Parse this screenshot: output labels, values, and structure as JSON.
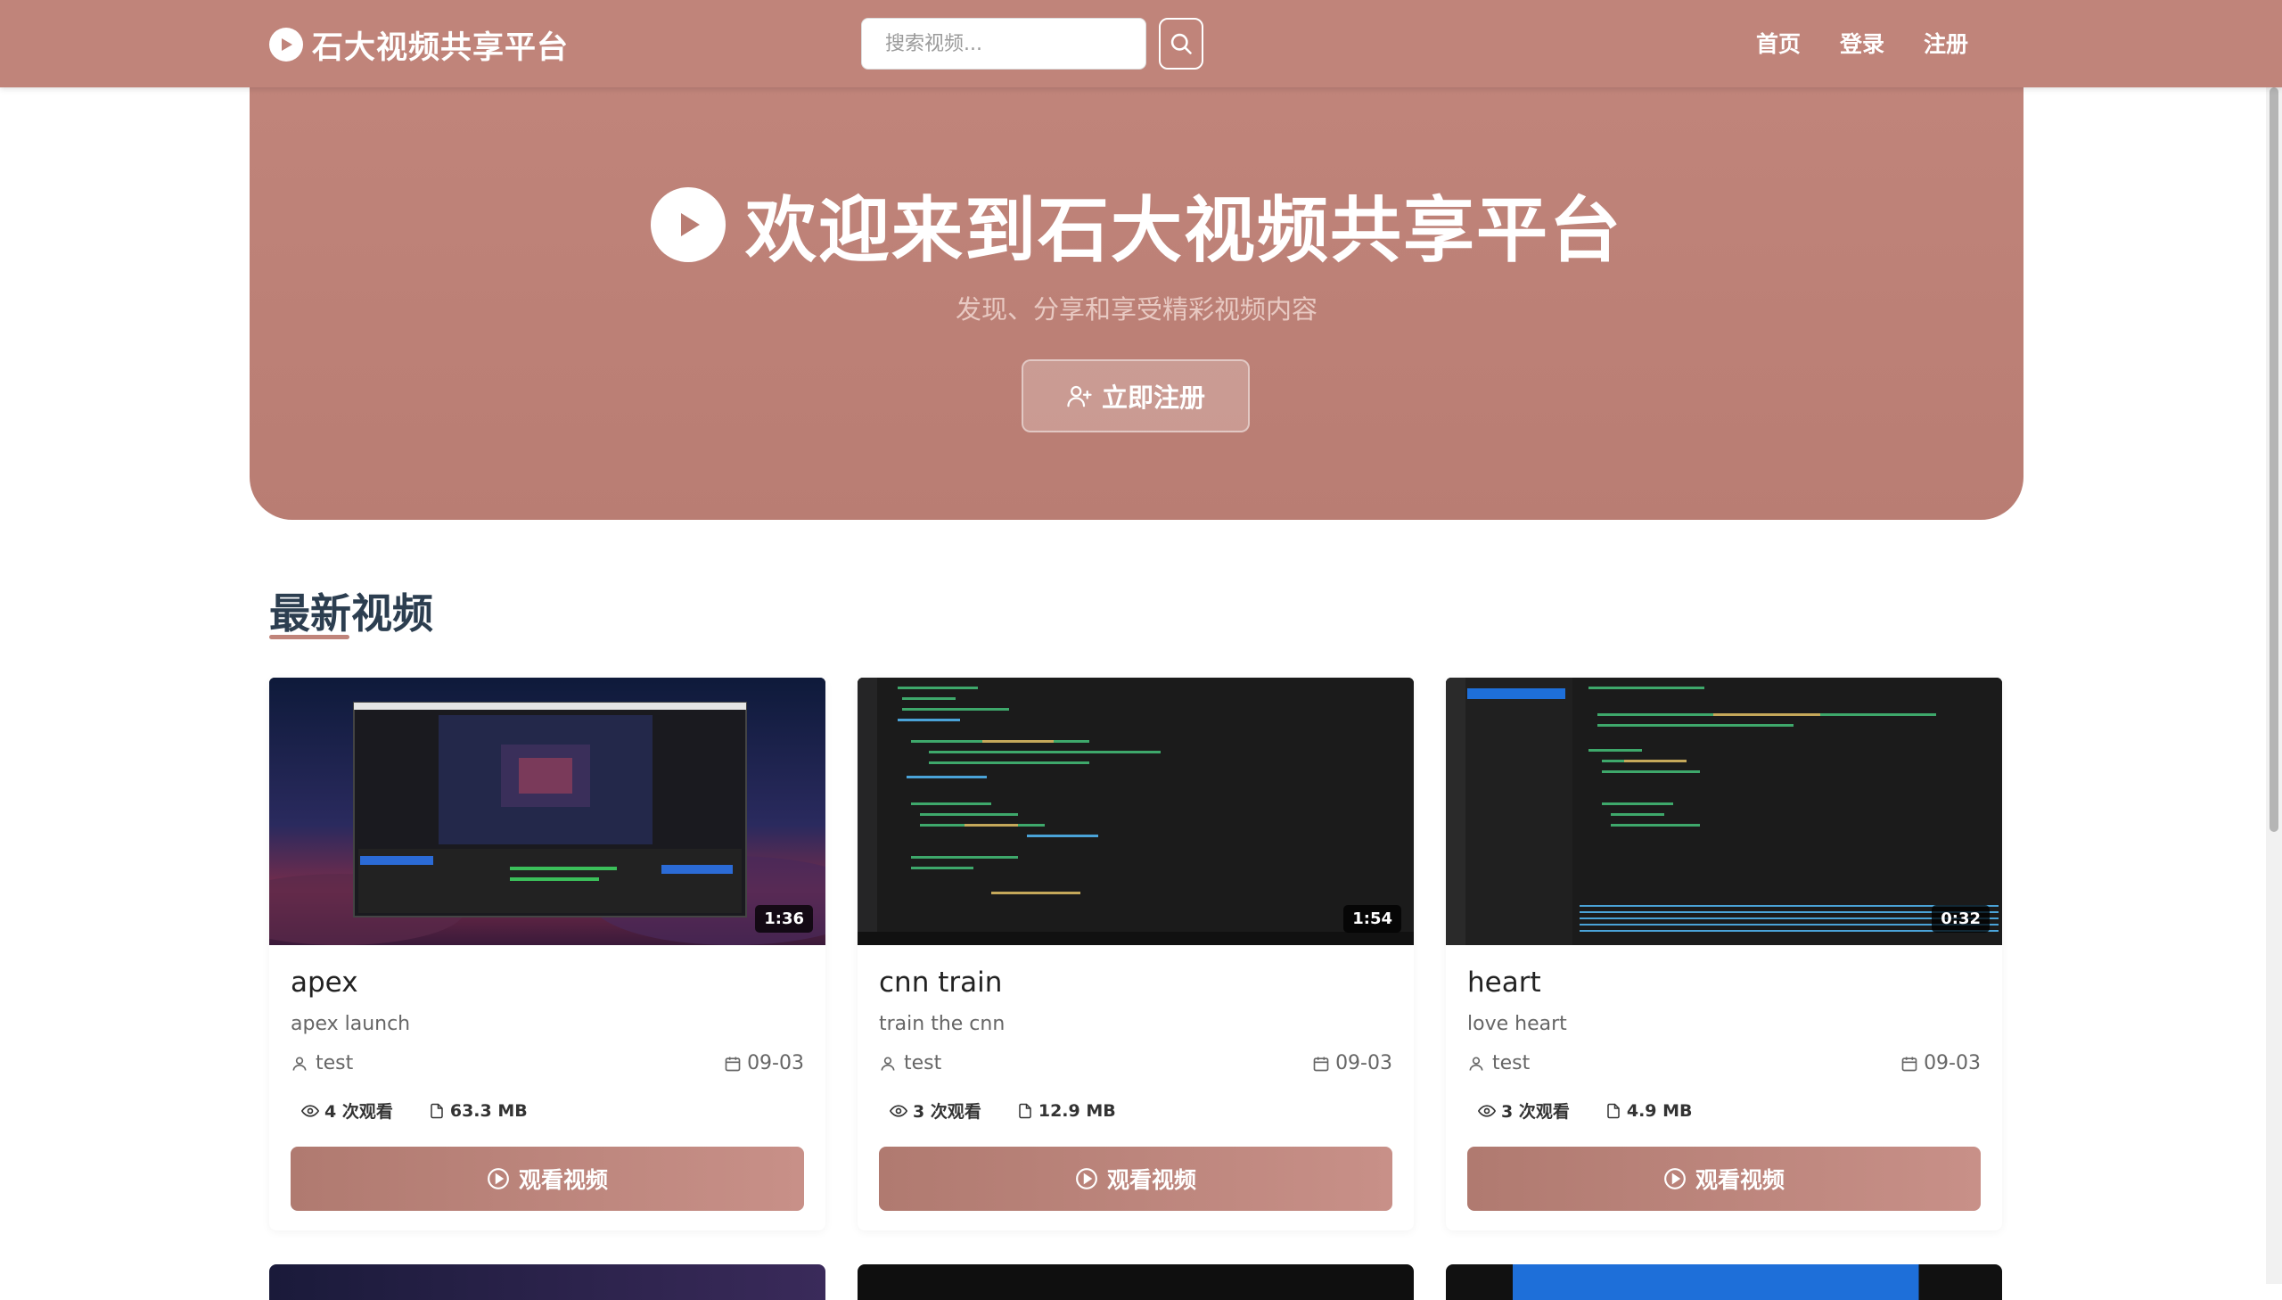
{
  "header": {
    "brand": "石大视频共享平台",
    "search_placeholder": "搜索视频...",
    "nav": [
      "首页",
      "登录",
      "注册"
    ]
  },
  "hero": {
    "title": "欢迎来到石大视频共享平台",
    "subtitle": "发现、分享和享受精彩视频内容",
    "cta": "立即注册"
  },
  "section": {
    "title": "最新视频"
  },
  "videos": [
    {
      "title": "apex",
      "description": "apex launch",
      "user": "test",
      "date": "09-03",
      "views": "4 次观看",
      "size": "63.3 MB",
      "duration": "1:36",
      "button": "观看视频"
    },
    {
      "title": "cnn train",
      "description": "train the cnn",
      "user": "test",
      "date": "09-03",
      "views": "3 次观看",
      "size": "12.9 MB",
      "duration": "1:54",
      "button": "观看视频"
    },
    {
      "title": "heart",
      "description": "love heart",
      "user": "test",
      "date": "09-03",
      "views": "3 次观看",
      "size": "4.9 MB",
      "duration": "0:32",
      "button": "观看视频"
    }
  ],
  "colors": {
    "primary": "#c0847a",
    "button_start": "#b07a70",
    "button_end": "#c89088",
    "heading": "#2c3e50"
  },
  "icons": [
    "play-circle-icon",
    "search-icon",
    "user-plus-icon",
    "user-icon",
    "calendar-icon",
    "eye-icon",
    "file-icon"
  ]
}
